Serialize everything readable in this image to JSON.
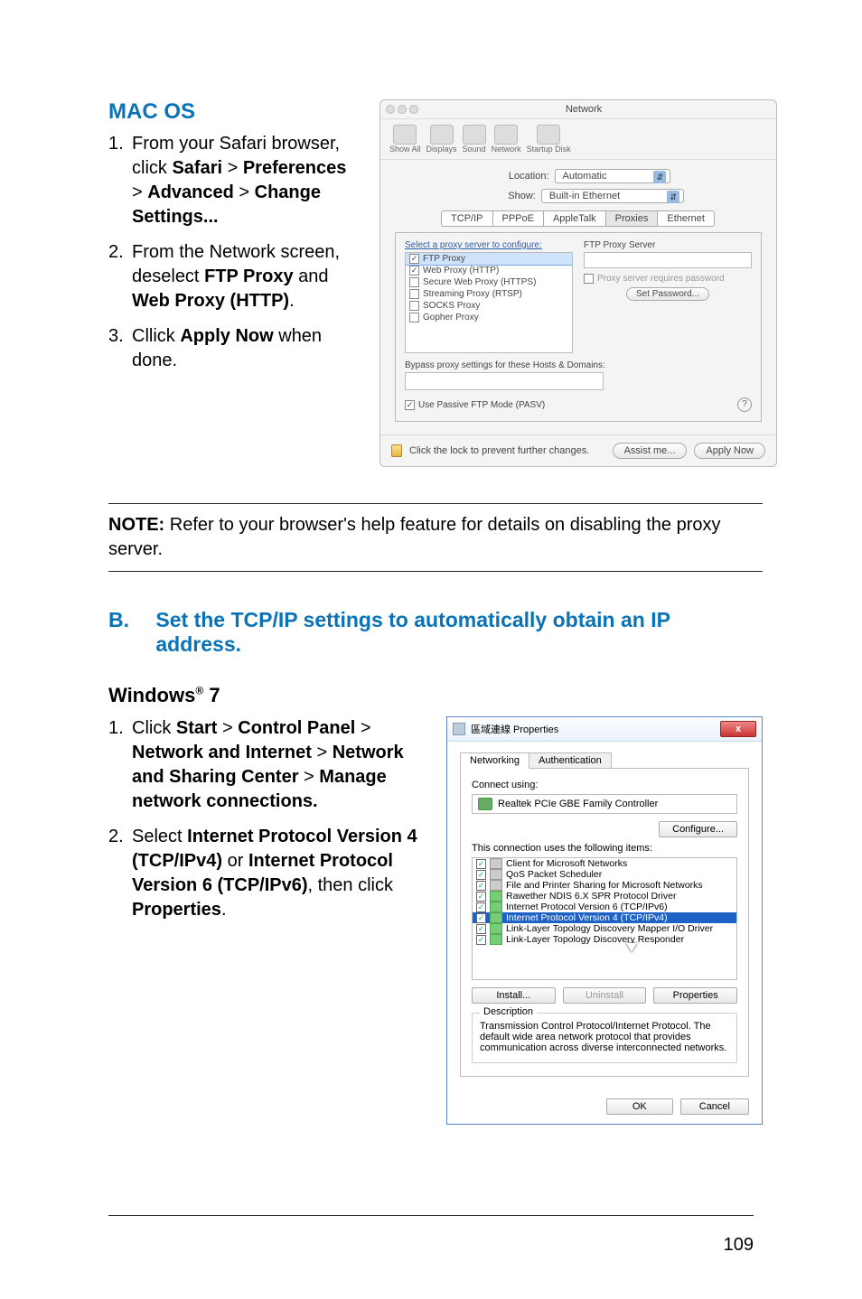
{
  "mac_section": {
    "heading": "MAC OS",
    "steps": [
      {
        "num": "1.",
        "segments": [
          {
            "t": "From your Safari browser, click "
          },
          {
            "t": "Safari",
            "b": true
          },
          {
            "t": " > "
          },
          {
            "t": "Preferences",
            "b": true
          },
          {
            "t": " > "
          },
          {
            "t": "Advanced",
            "b": true
          },
          {
            "t": " > "
          },
          {
            "t": "Change Settings...",
            "b": true
          }
        ]
      },
      {
        "num": "2.",
        "segments": [
          {
            "t": "From the Network screen, deselect "
          },
          {
            "t": "FTP Proxy",
            "b": true
          },
          {
            "t": " and "
          },
          {
            "t": "Web Proxy (HTTP)",
            "b": true
          },
          {
            "t": "."
          }
        ]
      },
      {
        "num": "3.",
        "segments": [
          {
            "t": "Cllick "
          },
          {
            "t": "Apply Now",
            "b": true
          },
          {
            "t": " when done."
          }
        ]
      }
    ]
  },
  "note": {
    "label": "NOTE:",
    "text": " Refer to your browser's help feature for details on disabling the proxy server."
  },
  "section_b": {
    "label": "B.",
    "title": "Set the TCP/IP settings to automatically obtain an IP address."
  },
  "win7": {
    "heading_prefix": "Windows",
    "heading_sup": "®",
    "heading_suffix": " 7",
    "steps": [
      {
        "num": "1.",
        "segments": [
          {
            "t": "Click "
          },
          {
            "t": "Start",
            "b": true
          },
          {
            "t": " > "
          },
          {
            "t": "Control Panel",
            "b": true
          },
          {
            "t": " > "
          },
          {
            "t": "Network and Internet",
            "b": true
          },
          {
            "t": " > "
          },
          {
            "t": "Network and Sharing Center",
            "b": true
          },
          {
            "t": " > "
          },
          {
            "t": "Manage network connections.",
            "b": true
          }
        ]
      },
      {
        "num": "2.",
        "segments": [
          {
            "t": "Select "
          },
          {
            "t": "Internet Protocol Version 4 (TCP/IPv4)",
            "b": true
          },
          {
            "t": " or "
          },
          {
            "t": "Internet Protocol Version 6 (TCP/IPv6)",
            "b": true
          },
          {
            "t": ", then click "
          },
          {
            "t": "Properties",
            "b": true
          },
          {
            "t": "."
          }
        ]
      }
    ]
  },
  "mac_window": {
    "title": "Network",
    "toolbar": [
      "Show All",
      "Displays",
      "Sound",
      "Network",
      "Startup Disk"
    ],
    "location_label": "Location:",
    "location_value": "Automatic",
    "show_label": "Show:",
    "show_value": "Built-in Ethernet",
    "tabs": [
      "TCP/IP",
      "PPPoE",
      "AppleTalk",
      "Proxies",
      "Ethernet"
    ],
    "active_tab": "Proxies",
    "select_link": "Select a proxy server to configure:",
    "proxy_server_label": "FTP Proxy Server",
    "requires_password": "Proxy server requires password",
    "set_password": "Set Password...",
    "proxy_list": [
      {
        "label": "FTP Proxy",
        "checked": true,
        "hilite": true
      },
      {
        "label": "Web Proxy (HTTP)",
        "checked": true
      },
      {
        "label": "Secure Web Proxy (HTTPS)",
        "checked": false
      },
      {
        "label": "Streaming Proxy (RTSP)",
        "checked": false
      },
      {
        "label": "SOCKS Proxy",
        "checked": false
      },
      {
        "label": "Gopher Proxy",
        "checked": false
      }
    ],
    "bypass_label": "Bypass proxy settings for these Hosts & Domains:",
    "passive_label": "Use Passive FTP Mode (PASV)",
    "lock_text": "Click the lock to prevent further changes.",
    "assist_btn": "Assist me...",
    "apply_btn": "Apply Now",
    "help": "?"
  },
  "win_dialog": {
    "title": "區域連線 Properties",
    "tabs": [
      "Networking",
      "Authentication"
    ],
    "connect_using": "Connect using:",
    "adapter": "Realtek PCIe GBE Family Controller",
    "configure": "Configure...",
    "uses_items": "This connection uses the following items:",
    "items": [
      {
        "label": "Client for Microsoft Networks",
        "cls": ""
      },
      {
        "label": "QoS Packet Scheduler",
        "cls": ""
      },
      {
        "label": "File and Printer Sharing for Microsoft Networks",
        "cls": ""
      },
      {
        "label": "Rawether NDIS 6.X SPR Protocol Driver",
        "cls": "green"
      },
      {
        "label": "Internet Protocol Version 6 (TCP/IPv6)",
        "cls": "green"
      },
      {
        "label": "Internet Protocol Version 4 (TCP/IPv4)",
        "cls": "green sel"
      },
      {
        "label": "Link-Layer Topology Discovery Mapper I/O Driver",
        "cls": "green"
      },
      {
        "label": "Link-Layer Topology Discovery Responder",
        "cls": "green"
      }
    ],
    "install": "Install...",
    "uninstall": "Uninstall",
    "properties": "Properties",
    "desc_label": "Description",
    "desc_text": "Transmission Control Protocol/Internet Protocol. The default wide area network protocol that provides communication across diverse interconnected networks.",
    "ok": "OK",
    "cancel": "Cancel"
  },
  "page_number": "109"
}
